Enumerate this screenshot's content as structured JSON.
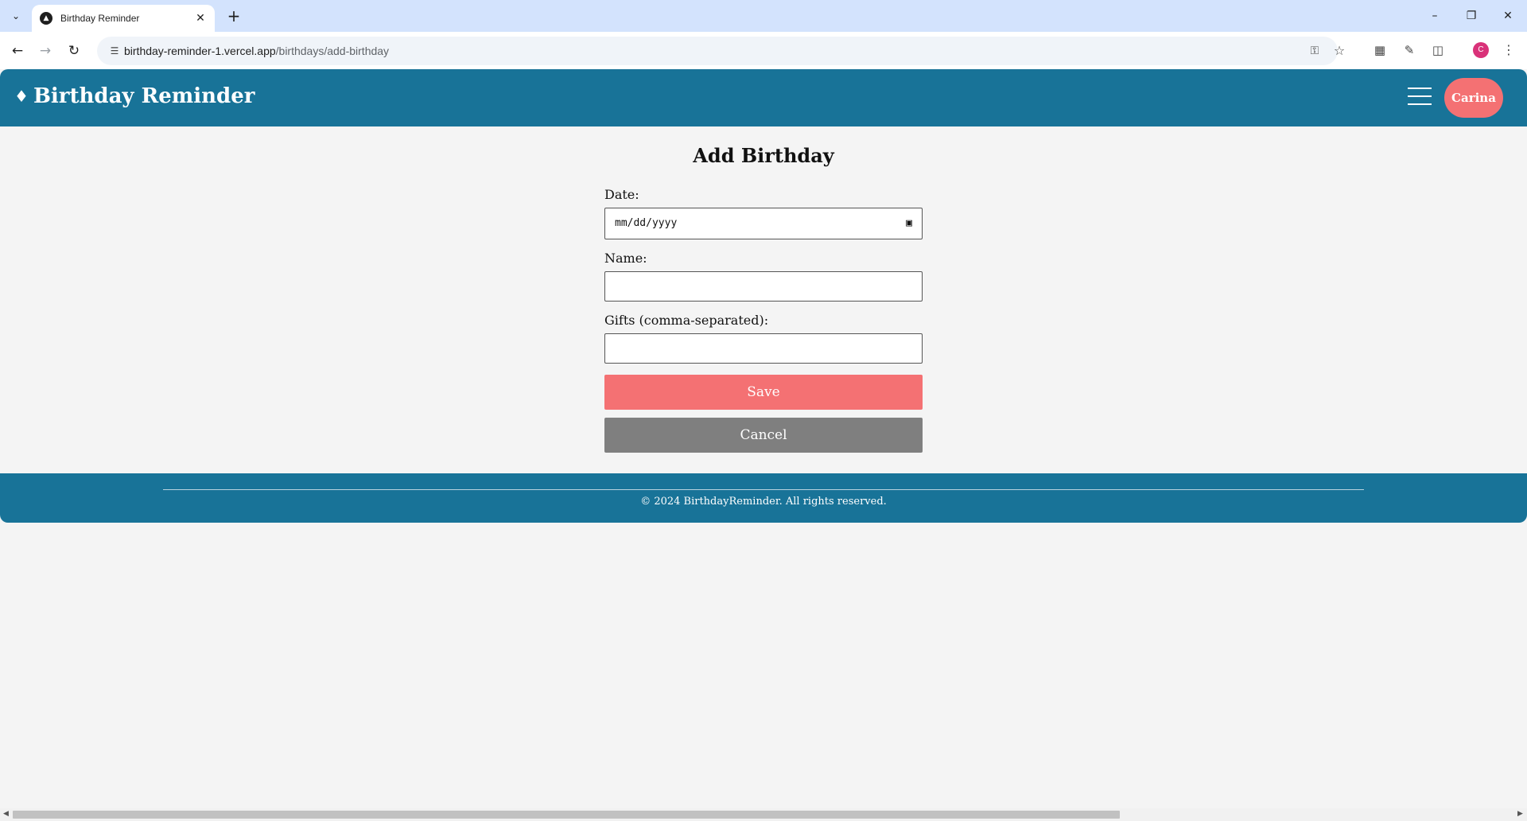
{
  "browser": {
    "tab_title": "Birthday Reminder",
    "url_host": "birthday-reminder-1.vercel.app",
    "url_path": "/birthdays/add-birthday",
    "profile_initial": "C",
    "icons": [
      "tab-search-icon",
      "favicon-icon",
      "close-tab-icon",
      "new-tab-icon",
      "minimize-icon",
      "restore-icon",
      "close-window-icon",
      "back-icon",
      "forward-icon",
      "reload-icon",
      "site-info-icon",
      "password-key-icon",
      "bookmark-star-icon",
      "extension-icon",
      "pen-icon",
      "puzzle-icon",
      "menu-dots-icon"
    ]
  },
  "header": {
    "brand": "Birthday Reminder",
    "brand_icon": "cake-icon",
    "user_name": "Carina",
    "menu_icon": "hamburger-icon"
  },
  "form": {
    "title": "Add Birthday",
    "date_label": "Date:",
    "date_placeholder": "mm/dd/yyyy",
    "name_label": "Name:",
    "name_value": "",
    "gifts_label": "Gifts (comma-separated):",
    "gifts_value": "",
    "save_label": "Save",
    "cancel_label": "Cancel"
  },
  "footer": {
    "copyright": "© 2024 BirthdayReminder. All rights reserved."
  },
  "colors": {
    "primary": "#187398",
    "accent": "#f47173",
    "cancel": "#7f7f7f",
    "background": "#f4f4f4"
  }
}
